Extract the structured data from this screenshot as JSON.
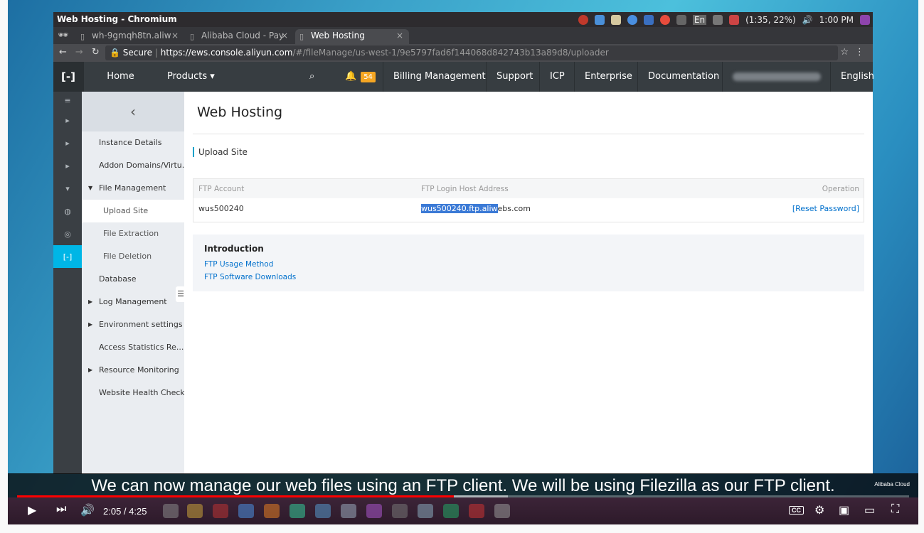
{
  "os": {
    "window_title": "Web Hosting - Chromium",
    "tray_text": "(1:35, 22%)",
    "clock": "1:00 PM",
    "lang": "En"
  },
  "browser": {
    "tabs": [
      {
        "label": "wh-9gmqh8tn.aliw",
        "close": "×"
      },
      {
        "label": "Alibaba Cloud - Pay",
        "close": "×"
      },
      {
        "label": "Web Hosting",
        "close": "×"
      }
    ],
    "secure_label": "Secure",
    "url_host": "https://ews.console.aliyun.com",
    "url_path": "/#/fileManage/us-west-1/9e5797fad6f144068d842743b13a89d8/uploader"
  },
  "topnav": {
    "home": "Home",
    "products": "Products ▾",
    "notif_count": "54",
    "billing": "Billing Management",
    "support": "Support",
    "icp": "ICP",
    "enterprise": "Enterprise",
    "docs": "Documentation",
    "lang": "English"
  },
  "sidebar": {
    "items": [
      {
        "label": "Instance Details"
      },
      {
        "label": "Addon Domains/Virtu..."
      },
      {
        "label": "File Management"
      },
      {
        "label": "Upload Site"
      },
      {
        "label": "File Extraction"
      },
      {
        "label": "File Deletion"
      },
      {
        "label": "Database"
      },
      {
        "label": "Log Management"
      },
      {
        "label": "Environment settings"
      },
      {
        "label": "Access Statistics Re..."
      },
      {
        "label": "Resource Monitoring"
      },
      {
        "label": "Website Health Check"
      }
    ]
  },
  "main": {
    "title": "Web Hosting",
    "subtitle": "Upload Site",
    "table": {
      "headers": [
        "FTP Account",
        "FTP Login Host Address",
        "Operation"
      ],
      "row": {
        "account": "wus500240",
        "host_selected": "wus500240.ftp.aliw",
        "host_rest": "ebs.com",
        "op": "[Reset Password]"
      }
    },
    "intro": {
      "title": "Introduction",
      "links": [
        "FTP Usage Method",
        "FTP Software Downloads"
      ]
    }
  },
  "video": {
    "caption": "We can now manage our web files using an FTP client. We will be using Filezilla as our FTP client.",
    "watermark": "Alibaba Cloud",
    "time": "2:05 / 4:25",
    "progress": 0.49,
    "buffered": 0.55,
    "cc": "CC"
  }
}
